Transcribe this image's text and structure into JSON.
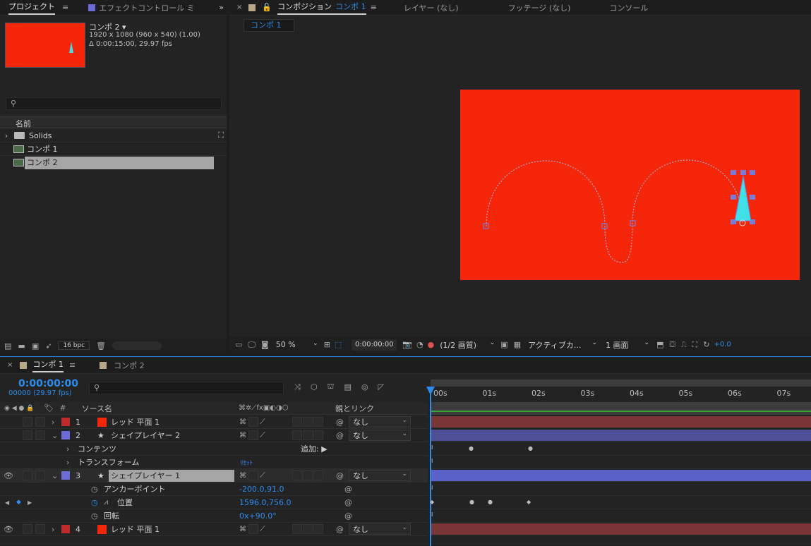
{
  "project": {
    "tab": "プロジェクト",
    "tab2": "エフェクトコントロール ミ",
    "comp_name": "コンポ 2 ▾",
    "comp_res": "1920 x 1080  (960 x 540) (1.00)",
    "comp_dur": "Δ 0:00:15:00, 29.97 fps",
    "col_name": "名前",
    "items": [
      {
        "name": "Solids"
      },
      {
        "name": "コンポ 1"
      },
      {
        "name": "コンポ 2"
      }
    ],
    "bpc": "16 bpc"
  },
  "viewer": {
    "tab_comp_prefix": "コンポジション",
    "tab_comp_name": "コンポ 1",
    "tab_layer": "レイヤー (なし)",
    "tab_footage": "フッテージ (なし)",
    "tab_console": "コンソール",
    "subtab": "コンポ 1",
    "zoom": "50 %",
    "time": "0:00:00:00",
    "quality": "(1/2 画質)",
    "camera": "アクティブカ...",
    "views": "1 画面",
    "exposure": "+0.0",
    "accent": "#2d8ceb",
    "bg": "#f5260a"
  },
  "timeline": {
    "tab1": "コンポ 1",
    "tab2": "コンポ 2",
    "current_time": "0:00:00:00",
    "frames": "00000 (29.97 fps)",
    "col_source": "ソース名",
    "col_parent": "親とリンク",
    "ruler": [
      "00s",
      "01s",
      "02s",
      "03s",
      "04s",
      "05s",
      "06s",
      "07s"
    ],
    "layers": [
      {
        "num": "1",
        "name": "レッド 平面 1",
        "color": "#c02a2a",
        "parent": "なし"
      },
      {
        "num": "2",
        "name": "シェイプレイヤー 2",
        "color": "#6c6cd9",
        "parent": "なし"
      },
      {
        "num": "3",
        "name": "シェイプレイヤー 1",
        "color": "#6c6cd9",
        "parent": "なし"
      },
      {
        "num": "4",
        "name": "レッド 平面 1",
        "color": "#c02a2a",
        "parent": "なし"
      }
    ],
    "contents": "コンテンツ",
    "add": "追加:",
    "transform": "トランスフォーム",
    "reset": "ﾘｾｯﾄ",
    "anchor_label": "アンカーポイント",
    "anchor_val": "-200.0,91.0",
    "position_label": "位置",
    "position_val": "1596.0,756.0",
    "rotation_label": "回転",
    "rotation_val": "0x+90.0°"
  }
}
